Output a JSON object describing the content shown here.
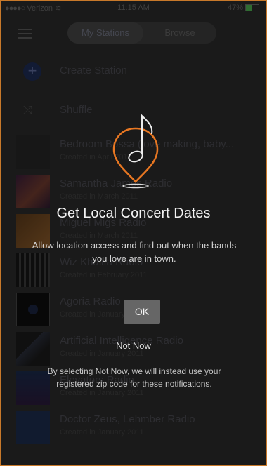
{
  "status": {
    "carrier": "Verizon",
    "time": "11:15 AM",
    "battery": "47%",
    "battery_level": 0.47
  },
  "nav": {
    "tabs": [
      {
        "label": "My Stations",
        "active": true
      },
      {
        "label": "Browse",
        "active": false
      }
    ]
  },
  "actions": [
    {
      "label": "Create Station",
      "icon": "plus-circle-icon"
    },
    {
      "label": "Shuffle",
      "icon": "shuffle-icon"
    }
  ],
  "stations": [
    {
      "title": "Bedroom Bossa (love making, baby...",
      "subtitle": "Created in April 2011"
    },
    {
      "title": "Samantha James Radio",
      "subtitle": "Created in March 2011"
    },
    {
      "title": "Miguel Migs Radio",
      "subtitle": "Created in March 2011"
    },
    {
      "title": "Wiz Khalifa Radio",
      "subtitle": "Created in February 2011"
    },
    {
      "title": "Agoria Radio",
      "subtitle": "Created in January 2011"
    },
    {
      "title": "Artificial Intelligence Radio",
      "subtitle": "Created in January 2011"
    },
    {
      "title": "Elevators Radio",
      "subtitle": "Created in January 2011"
    },
    {
      "title": "Doctor Zeus, Lehmber Radio",
      "subtitle": "Created in January 2011"
    }
  ],
  "modal": {
    "title": "Get Local Concert Dates",
    "body": "Allow location access and find out when the bands you love are in town.",
    "ok_label": "OK",
    "not_now_label": "Not Now",
    "footnote": "By selecting Not Now, we will instead use your registered zip code for these notifications.",
    "accent_color": "#e87722"
  }
}
